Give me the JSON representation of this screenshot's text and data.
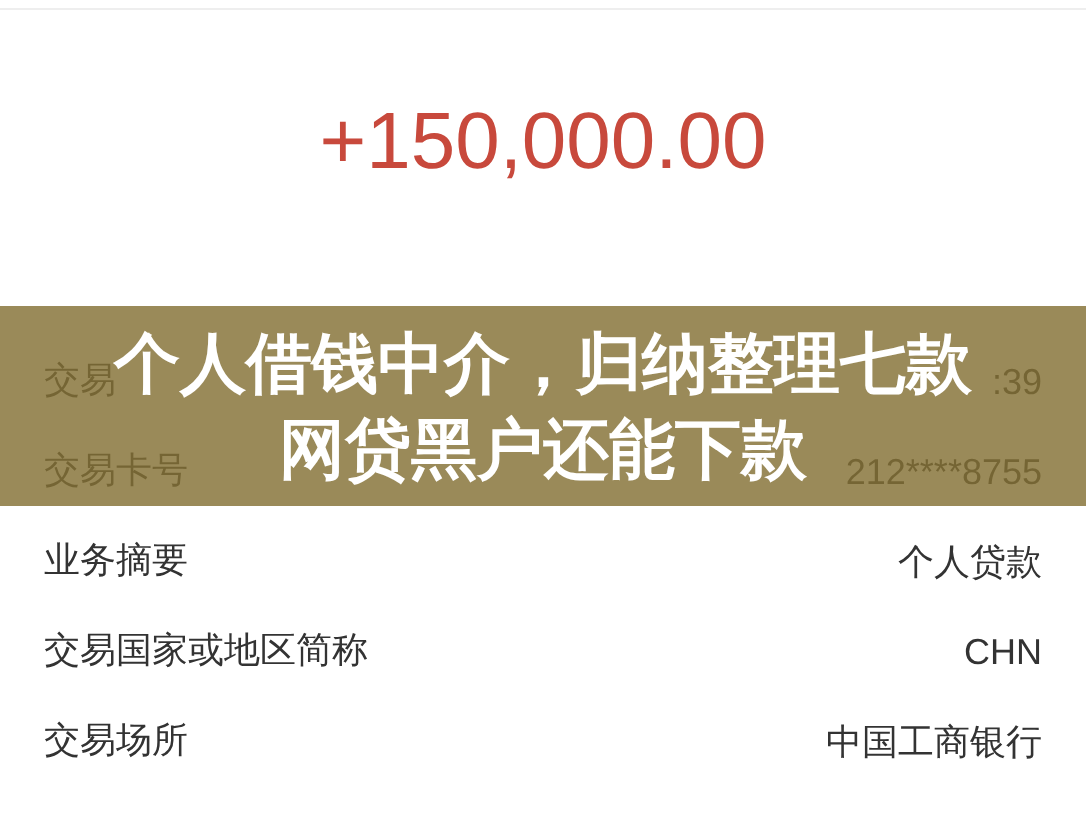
{
  "amount": "+150,000.00",
  "rows": [
    {
      "label": "交易",
      "value": ":39"
    },
    {
      "label": "交易卡号",
      "value": "212****8755"
    },
    {
      "label": "业务摘要",
      "value": "个人贷款"
    },
    {
      "label": "交易国家或地区简称",
      "value": "CHN"
    },
    {
      "label": "交易场所",
      "value": "中国工商银行"
    }
  ],
  "banner": {
    "lines": [
      "个人借钱中介，归纳整理七款",
      "网贷黑户还能下款"
    ]
  }
}
